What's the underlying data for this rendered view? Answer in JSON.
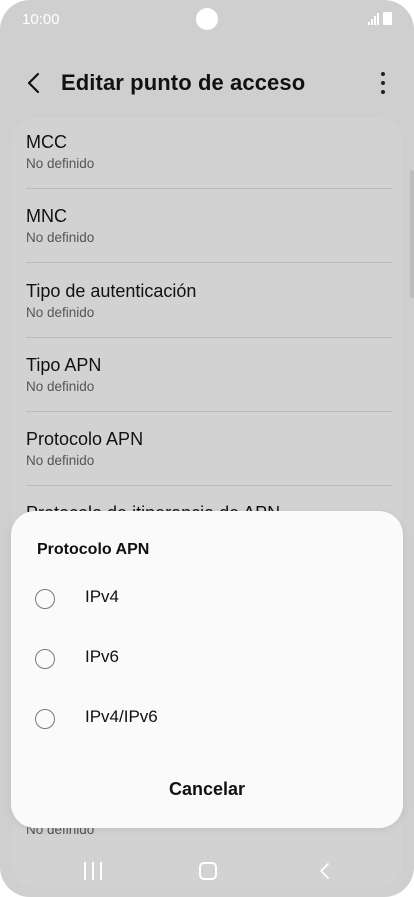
{
  "status_bar": {
    "time": "10:00"
  },
  "header": {
    "title": "Editar punto de acceso"
  },
  "settings_list": {
    "items": [
      {
        "title": "MCC",
        "subtitle": "No definido"
      },
      {
        "title": "MNC",
        "subtitle": "No definido"
      },
      {
        "title": "Tipo de autenticación",
        "subtitle": "No definido"
      },
      {
        "title": "Tipo APN",
        "subtitle": "No definido"
      },
      {
        "title": "Protocolo APN",
        "subtitle": "No definido"
      },
      {
        "title": "Protocolo de itinerancia de APN",
        "subtitle": ""
      }
    ],
    "last_subtitle": "No definido"
  },
  "dialog": {
    "title": "Protocolo APN",
    "options": [
      {
        "label": "IPv4"
      },
      {
        "label": "IPv6"
      },
      {
        "label": "IPv4/IPv6"
      }
    ],
    "cancel_label": "Cancelar"
  },
  "icons": {
    "back": "back-arrow-icon",
    "more": "more-vertical-icon",
    "nav_recents": "recents-icon",
    "nav_home": "home-icon",
    "nav_back": "nav-back-icon"
  },
  "colors": {
    "overlay_bg": "#cfcfcf",
    "dialog_bg": "#fafafa",
    "text_primary": "#111111",
    "text_secondary": "#555555"
  }
}
